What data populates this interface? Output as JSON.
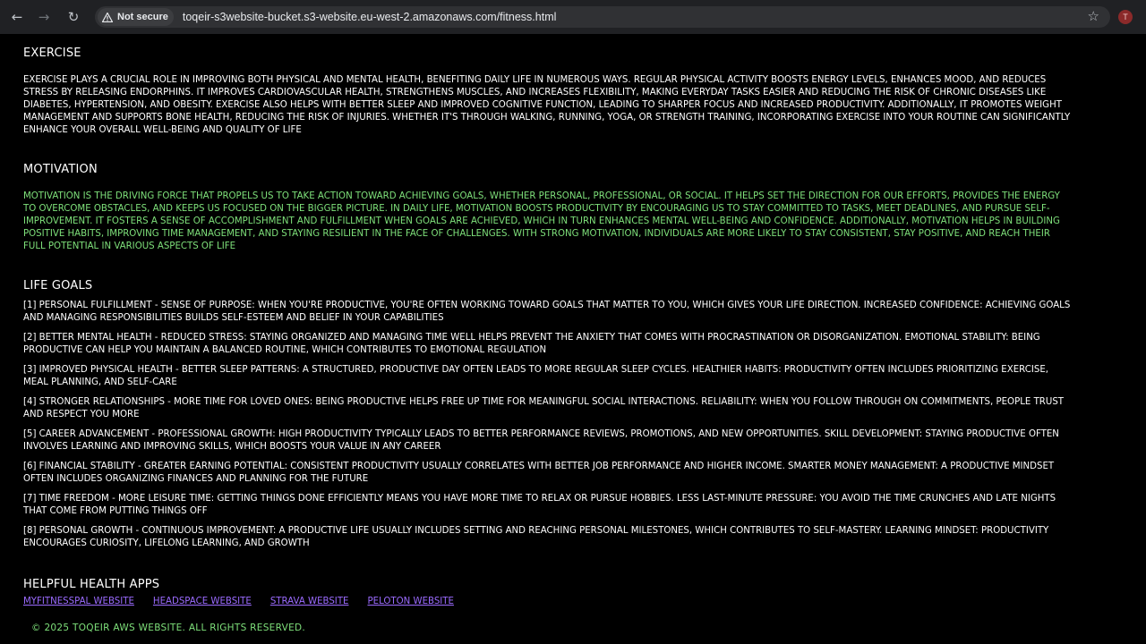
{
  "browser": {
    "security_label": "Not secure",
    "url": "toqeir-s3website-bucket.s3-website.eu-west-2.amazonaws.com/fitness.html",
    "profile_initial": "T"
  },
  "exercise": {
    "title": "EXERCISE",
    "text": "EXERCISE PLAYS A CRUCIAL ROLE IN IMPROVING BOTH PHYSICAL AND MENTAL HEALTH, BENEFITING DAILY LIFE IN NUMEROUS WAYS. REGULAR PHYSICAL ACTIVITY BOOSTS ENERGY LEVELS, ENHANCES MOOD, AND REDUCES STRESS BY RELEASING ENDORPHINS. IT IMPROVES CARDIOVASCULAR HEALTH, STRENGTHENS MUSCLES, AND INCREASES FLEXIBILITY, MAKING EVERYDAY TASKS EASIER AND REDUCING THE RISK OF CHRONIC DISEASES LIKE DIABETES, HYPERTENSION, AND OBESITY. EXERCISE ALSO HELPS WITH BETTER SLEEP AND IMPROVED COGNITIVE FUNCTION, LEADING TO SHARPER FOCUS AND INCREASED PRODUCTIVITY. ADDITIONALLY, IT PROMOTES WEIGHT MANAGEMENT AND SUPPORTS BONE HEALTH, REDUCING THE RISK OF INJURIES. WHETHER IT'S THROUGH WALKING, RUNNING, YOGA, OR STRENGTH TRAINING, INCORPORATING EXERCISE INTO YOUR ROUTINE CAN SIGNIFICANTLY ENHANCE YOUR OVERALL WELL-BEING AND QUALITY OF LIFE"
  },
  "motivation": {
    "title": "MOTIVATION",
    "text": "MOTIVATION IS THE DRIVING FORCE THAT PROPELS US TO TAKE ACTION TOWARD ACHIEVING GOALS, WHETHER PERSONAL, PROFESSIONAL, OR SOCIAL. IT HELPS SET THE DIRECTION FOR OUR EFFORTS, PROVIDES THE ENERGY TO OVERCOME OBSTACLES, AND KEEPS US FOCUSED ON THE BIGGER PICTURE. IN DAILY LIFE, MOTIVATION BOOSTS PRODUCTIVITY BY ENCOURAGING US TO STAY COMMITTED TO TASKS, MEET DEADLINES, AND PURSUE SELF-IMPROVEMENT. IT FOSTERS A SENSE OF ACCOMPLISHMENT AND FULFILLMENT WHEN GOALS ARE ACHIEVED, WHICH IN TURN ENHANCES MENTAL WELL-BEING AND CONFIDENCE. ADDITIONALLY, MOTIVATION HELPS IN BUILDING POSITIVE HABITS, IMPROVING TIME MANAGEMENT, AND STAYING RESILIENT IN THE FACE OF CHALLENGES. WITH STRONG MOTIVATION, INDIVIDUALS ARE MORE LIKELY TO STAY CONSISTENT, STAY POSITIVE, AND REACH THEIR FULL POTENTIAL IN VARIOUS ASPECTS OF LIFE"
  },
  "life_goals": {
    "title": "LIFE GOALS",
    "items": [
      "[1] PERSONAL FULFILLMENT - SENSE OF PURPOSE: WHEN YOU'RE PRODUCTIVE, YOU'RE OFTEN WORKING TOWARD GOALS THAT MATTER TO YOU, WHICH GIVES YOUR LIFE DIRECTION. INCREASED CONFIDENCE: ACHIEVING GOALS AND MANAGING RESPONSIBILITIES BUILDS SELF-ESTEEM AND BELIEF IN YOUR CAPABILITIES",
      "[2] BETTER MENTAL HEALTH - REDUCED STRESS: STAYING ORGANIZED AND MANAGING TIME WELL HELPS PREVENT THE ANXIETY THAT COMES WITH PROCRASTINATION OR DISORGANIZATION. EMOTIONAL STABILITY: BEING PRODUCTIVE CAN HELP YOU MAINTAIN A BALANCED ROUTINE, WHICH CONTRIBUTES TO EMOTIONAL REGULATION",
      "[3] IMPROVED PHYSICAL HEALTH - BETTER SLEEP PATTERNS: A STRUCTURED, PRODUCTIVE DAY OFTEN LEADS TO MORE REGULAR SLEEP CYCLES. HEALTHIER HABITS: PRODUCTIVITY OFTEN INCLUDES PRIORITIZING EXERCISE, MEAL PLANNING, AND SELF-CARE",
      "[4] STRONGER RELATIONSHIPS - MORE TIME FOR LOVED ONES: BEING PRODUCTIVE HELPS FREE UP TIME FOR MEANINGFUL SOCIAL INTERACTIONS. RELIABILITY: WHEN YOU FOLLOW THROUGH ON COMMITMENTS, PEOPLE TRUST AND RESPECT YOU MORE",
      "[5] CAREER ADVANCEMENT - PROFESSIONAL GROWTH: HIGH PRODUCTIVITY TYPICALLY LEADS TO BETTER PERFORMANCE REVIEWS, PROMOTIONS, AND NEW OPPORTUNITIES. SKILL DEVELOPMENT: STAYING PRODUCTIVE OFTEN INVOLVES LEARNING AND IMPROVING SKILLS, WHICH BOOSTS YOUR VALUE IN ANY CAREER",
      "[6] FINANCIAL STABILITY - GREATER EARNING POTENTIAL: CONSISTENT PRODUCTIVITY USUALLY CORRELATES WITH BETTER JOB PERFORMANCE AND HIGHER INCOME. SMARTER MONEY MANAGEMENT: A PRODUCTIVE MINDSET OFTEN INCLUDES ORGANIZING FINANCES AND PLANNING FOR THE FUTURE",
      "[7] TIME FREEDOM - MORE LEISURE TIME: GETTING THINGS DONE EFFICIENTLY MEANS YOU HAVE MORE TIME TO RELAX OR PURSUE HOBBIES. LESS LAST-MINUTE PRESSURE: YOU AVOID THE TIME CRUNCHES AND LATE NIGHTS THAT COME FROM PUTTING THINGS OFF",
      "[8] PERSONAL GROWTH - CONTINUOUS IMPROVEMENT: A PRODUCTIVE LIFE USUALLY INCLUDES SETTING AND REACHING PERSONAL MILESTONES, WHICH CONTRIBUTES TO SELF-MASTERY. LEARNING MINDSET: PRODUCTIVITY ENCOURAGES CURIOSITY, LIFELONG LEARNING, AND GROWTH"
    ]
  },
  "apps": {
    "title": "HELPFUL HEALTH APPS",
    "links": [
      "MYFITNESSPAL WEBSITE",
      "HEADSPACE WEBSITE",
      "STRAVA WEBSITE",
      "PELOTON WEBSITE"
    ]
  },
  "footer": {
    "text": "© 2025 TOQEIR AWS WEBSITE. ALL RIGHTS RESERVED."
  },
  "colors": {
    "background": "#000000",
    "motivation_text": "#7ee07a",
    "link": "#9b6bff",
    "chrome": "#202124"
  }
}
